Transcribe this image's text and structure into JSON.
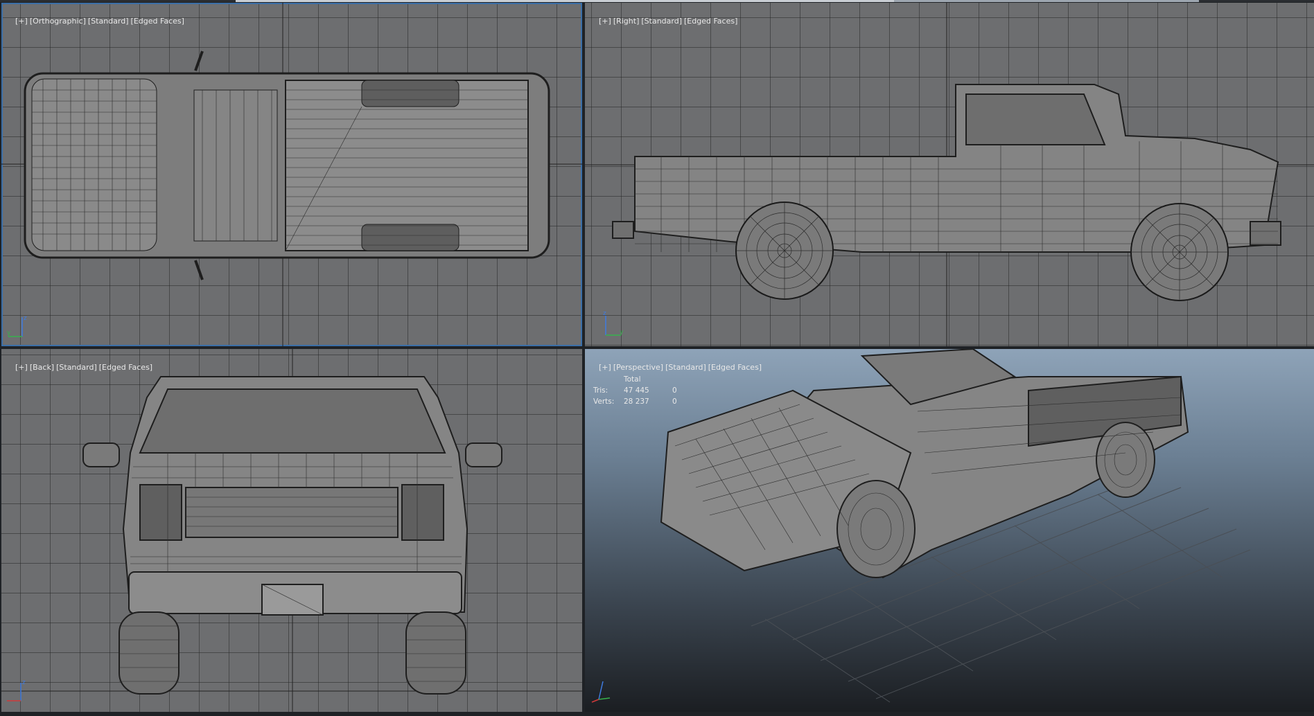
{
  "viewports": {
    "top": {
      "labels": [
        "[+]",
        "[Orthographic]",
        "[Standard]",
        "[Edged Faces]"
      ]
    },
    "right": {
      "labels": [
        "[+]",
        "[Right]",
        "[Standard]",
        "[Edged Faces]"
      ]
    },
    "back": {
      "labels": [
        "[+]",
        "[Back]",
        "[Standard]",
        "[Edged Faces]"
      ]
    },
    "perspective": {
      "labels": [
        "[+]",
        "[Perspective]",
        "[Standard]",
        "[Edged Faces]"
      ],
      "stats": {
        "header": "Total",
        "tris_label": "Tris:",
        "tris_total": "47 445",
        "tris_sel": "0",
        "verts_label": "Verts:",
        "verts_total": "28 237",
        "verts_sel": "0"
      }
    }
  },
  "axis": {
    "x": "x",
    "y": "y",
    "z": "z"
  },
  "icons": [
    "axis-gizmo-icon"
  ],
  "colors": {
    "active_border": "#3b6fa8",
    "viewport_bg": "#6d6e70",
    "axis_x": "#d03a3a",
    "axis_y": "#37b24d",
    "axis_z": "#3f7be0"
  }
}
